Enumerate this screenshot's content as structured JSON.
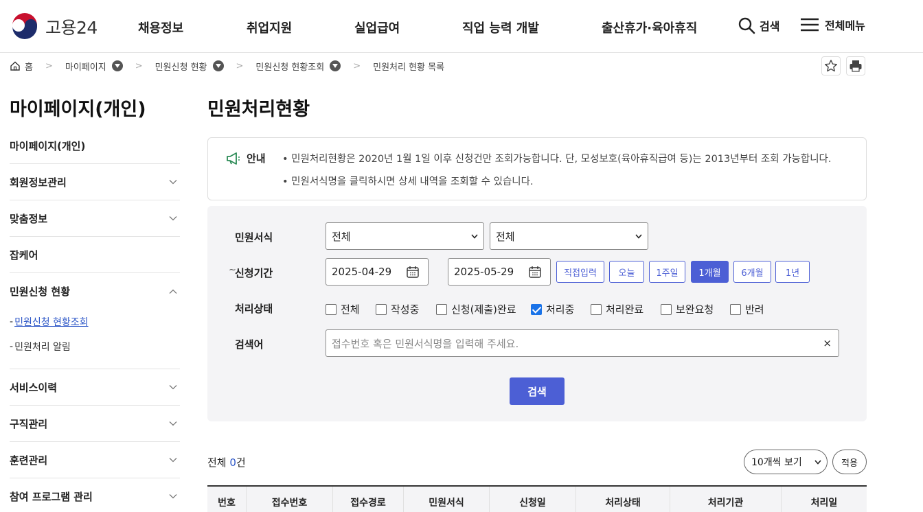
{
  "header": {
    "logo_text": "고용24",
    "nav": [
      "채용정보",
      "취업지원",
      "실업급여",
      "직업 능력 개발",
      "출산휴가·육아휴직"
    ],
    "search_label": "검색",
    "menu_label": "전체메뉴"
  },
  "breadcrumb": {
    "home": "홈",
    "items": [
      "마이페이지",
      "민원신청 현황",
      "민원신청 현황조회"
    ],
    "current": "민원처리 현황 목록"
  },
  "sidebar": {
    "title": "마이페이지(개인)",
    "items": [
      "마이페이지(개인)",
      "회원정보관리",
      "맞춤정보",
      "잡케어",
      "민원신청 현황",
      "서비스이력",
      "구직관리",
      "훈련관리",
      "참여 프로그램 관리"
    ],
    "sub_items": [
      "민원신청 현황조회",
      "민원처리 알림"
    ]
  },
  "main": {
    "title": "민원처리현황",
    "notice": {
      "label": "안내",
      "lines": [
        "• 민원처리현황은 2020년 1월 1일 이후 신청건만 조회가능합니다. 단, 모성보호(육아휴직급여 등)는 2013년부터 조회 가능합니다.",
        "• 민원서식명을 클릭하시면 상세 내역을 조회할 수 있습니다."
      ]
    },
    "filter": {
      "form_label": "민원서식",
      "form_select1": "전체",
      "form_select2": "전체",
      "period_label": "신청기간",
      "date_from": "2025-04-29",
      "date_sep": "~",
      "date_to": "2025-05-29",
      "period_buttons": [
        "직접입력",
        "오늘",
        "1주일",
        "1개월",
        "6개월",
        "1년"
      ],
      "period_selected": "1개월",
      "status_label": "처리상태",
      "statuses": [
        "전체",
        "작성중",
        "신청(제출)완료",
        "처리중",
        "처리완료",
        "보완요청",
        "반려"
      ],
      "status_checked": "처리중",
      "keyword_label": "검색어",
      "keyword_placeholder": "접수번호 혹은 민원서식명을 입력해 주세요.",
      "clear_symbol": "×",
      "search_button": "검색"
    },
    "results": {
      "total_prefix": "전체 ",
      "total_count": "0",
      "total_suffix": "건",
      "page_size": "10개씩 보기",
      "apply_button": "적용",
      "columns": [
        "번호",
        "접수번호",
        "접수경로",
        "민원서식",
        "신청일",
        "처리상태",
        "처리기관",
        "처리일"
      ]
    }
  },
  "colors": {
    "accent": "#4c5fd5",
    "link": "#2c56c7",
    "panel_bg": "#f4f4f6"
  }
}
